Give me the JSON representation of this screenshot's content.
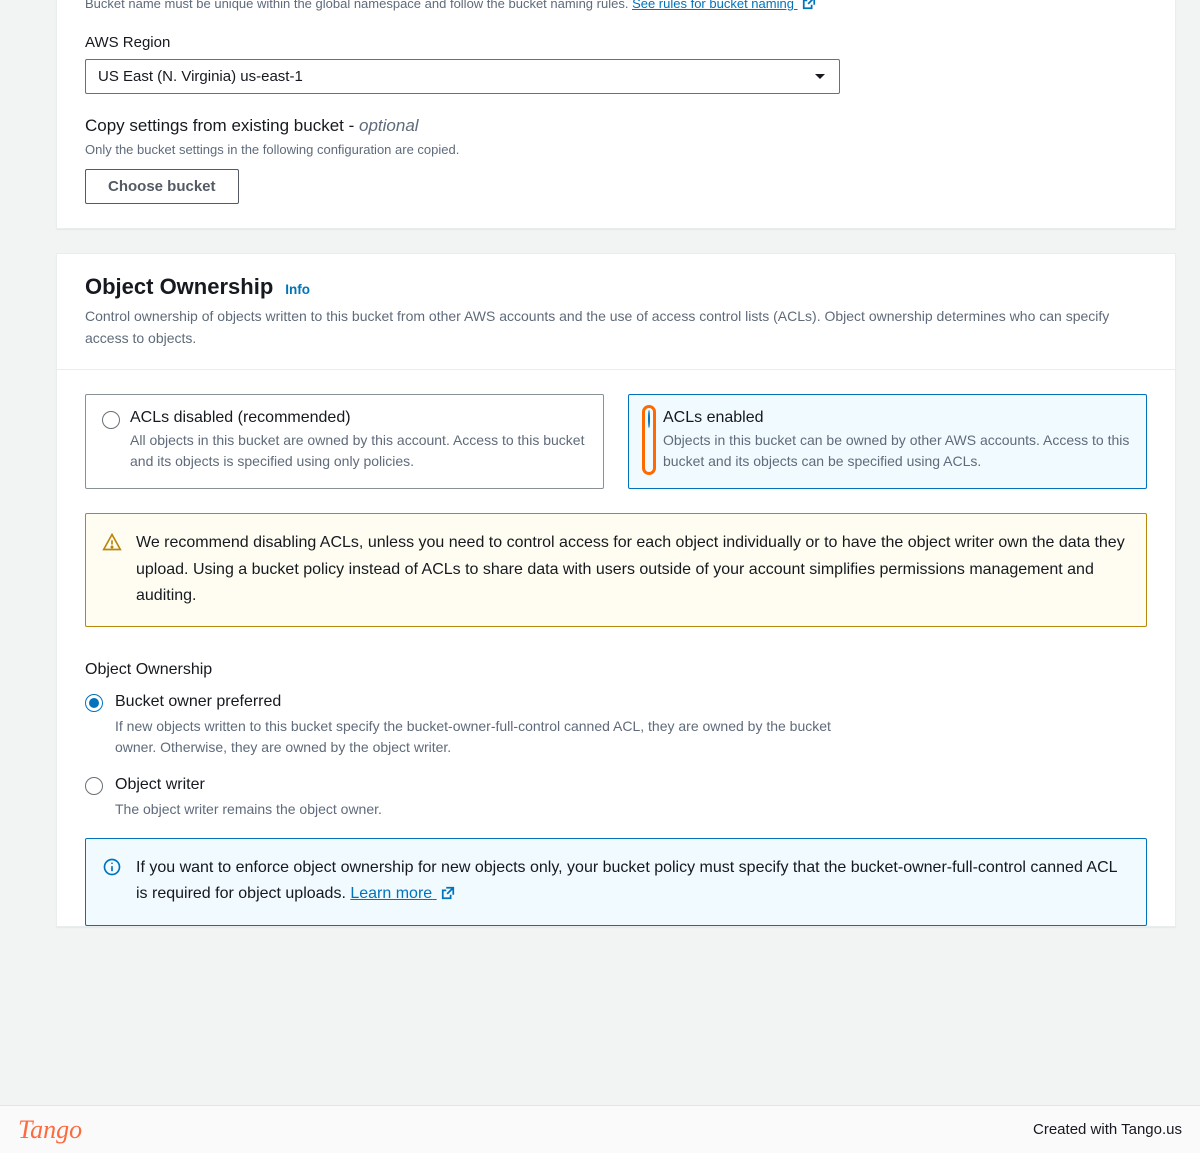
{
  "general": {
    "bucket_name_help": "Bucket name must be unique within the global namespace and follow the bucket naming rules.",
    "rules_link": "See rules for bucket naming",
    "region_label": "AWS Region",
    "region_value": "US East (N. Virginia) us-east-1",
    "copy_label_prefix": "Copy settings from existing bucket - ",
    "copy_label_optional": "optional",
    "copy_help": "Only the bucket settings in the following configuration are copied.",
    "choose_bucket_btn": "Choose bucket"
  },
  "ownership": {
    "title": "Object Ownership",
    "info": "Info",
    "desc": "Control ownership of objects written to this bucket from other AWS accounts and the use of access control lists (ACLs). Object ownership determines who can specify access to objects.",
    "tiles": {
      "disabled": {
        "title": "ACLs disabled (recommended)",
        "desc": "All objects in this bucket are owned by this account. Access to this bucket and its objects is specified using only policies."
      },
      "enabled": {
        "title": "ACLs enabled",
        "desc": "Objects in this bucket can be owned by other AWS accounts. Access to this bucket and its objects can be specified using ACLs."
      }
    },
    "warning": "We recommend disabling ACLs, unless you need to control access for each object individually or to have the object writer own the data they upload. Using a bucket policy instead of ACLs to share data with users outside of your account simplifies permissions management and auditing.",
    "sub_label": "Object Ownership",
    "options": {
      "preferred": {
        "title": "Bucket owner preferred",
        "desc": "If new objects written to this bucket specify the bucket-owner-full-control canned ACL, they are owned by the bucket owner. Otherwise, they are owned by the object writer."
      },
      "writer": {
        "title": "Object writer",
        "desc": "The object writer remains the object owner."
      }
    },
    "info_alert_prefix": "If you want to enforce object ownership for new objects only, your bucket policy must specify that the bucket-owner-full-control canned ACL is required for object uploads. ",
    "learn_more": "Learn more"
  },
  "footer": {
    "brand": "Tango",
    "credit": "Created with Tango.us"
  }
}
